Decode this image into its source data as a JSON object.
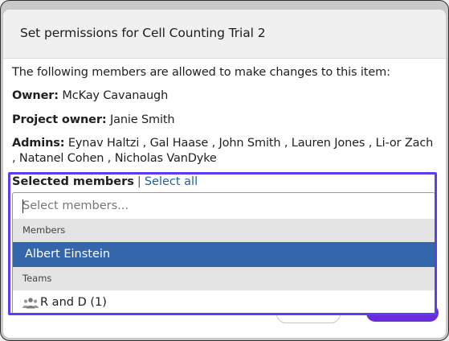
{
  "dialog": {
    "title": "Set permissions for Cell Counting Trial 2",
    "intro": "The following members are allowed to make changes to this item:",
    "owner_label": "Owner:",
    "owner_value": "McKay Cavanaugh",
    "project_owner_label": "Project owner:",
    "project_owner_value": "Janie Smith",
    "admins_label": "Admins:",
    "admins_line1": "Eynav Haltzi , Gal Haase , John Smith , Lauren Jones , Li-or Zach",
    "admins_line2": ", Natanel Cohen , Nicholas VanDyke"
  },
  "selected_members": {
    "label": "Selected members",
    "separator": "|",
    "select_all": "Select all",
    "placeholder": "Select members...",
    "value": ""
  },
  "dropdown": {
    "groups": [
      {
        "header": "Members",
        "options": [
          {
            "label": "Albert Einstein",
            "highlighted": true
          }
        ]
      },
      {
        "header": "Teams",
        "options": [
          {
            "label": "R and D (1)",
            "icon": "team-icon",
            "highlighted": false
          }
        ]
      }
    ]
  },
  "colors": {
    "highlight": "#3366aa",
    "focus_ring": "#5b3df5",
    "link": "#1f5fa3",
    "primary_button": "#6a2bd9"
  }
}
